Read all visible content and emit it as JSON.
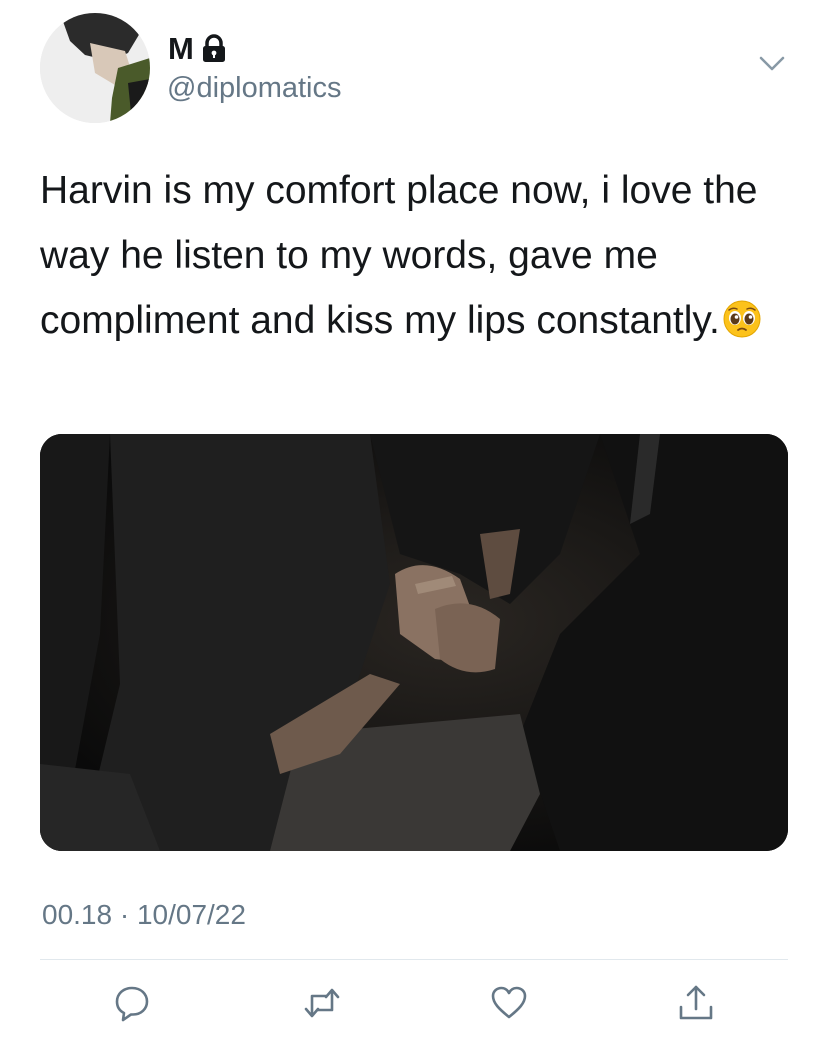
{
  "author": {
    "display_name": "M",
    "handle": "@diplomatics",
    "avatar_icon": "profile-photo",
    "protected_icon": "lock-icon"
  },
  "tweet": {
    "text": "Harvin is my comfort place now, i love the way he listen to my words, gave me compliment and kiss my lips constantly.",
    "emoji": "pleading-face-emoji",
    "media": {
      "kind": "photo"
    },
    "timestamp": "00.18 · 10/07/22"
  },
  "actions": {
    "reply_icon": "reply-icon",
    "retweet_icon": "retweet-icon",
    "like_icon": "heart-icon",
    "share_icon": "share-icon"
  },
  "colors": {
    "text_primary": "#14171a",
    "text_secondary": "#657786",
    "divider": "#e1e8ed",
    "icon": "#657786"
  }
}
